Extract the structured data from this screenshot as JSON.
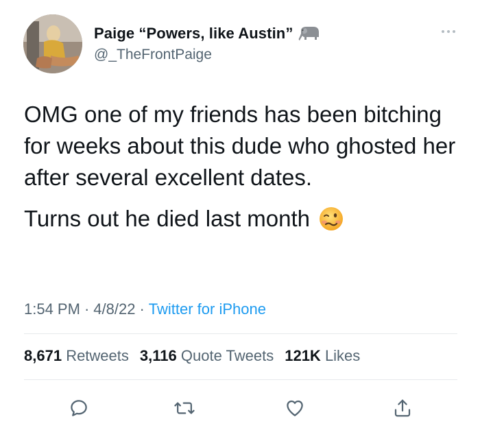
{
  "author": {
    "display_name": "Paige “Powers, like Austin”",
    "handle": "@_TheFrontPaige",
    "name_emoji": "elephant-icon"
  },
  "tweet": {
    "paragraph1": "OMG one of my friends has been bitching for weeks about this dude who ghosted her after several excellent dates.",
    "paragraph2": "Turns out he died last month",
    "paragraph2_emoji": "woozy-face-emoji"
  },
  "meta": {
    "time": "1:54 PM",
    "date": "4/8/22",
    "separator": "·",
    "source": "Twitter for iPhone"
  },
  "stats": {
    "retweets_count": "8,671",
    "retweets_label": "Retweets",
    "quotes_count": "3,116",
    "quotes_label": "Quote Tweets",
    "likes_count": "121K",
    "likes_label": "Likes"
  },
  "actions": [
    "reply-icon",
    "retweet-icon",
    "like-icon",
    "share-icon"
  ],
  "colors": {
    "text": "#0f1419",
    "secondary": "#536471",
    "link": "#1d9bf0",
    "divider": "#e6e9ec"
  }
}
